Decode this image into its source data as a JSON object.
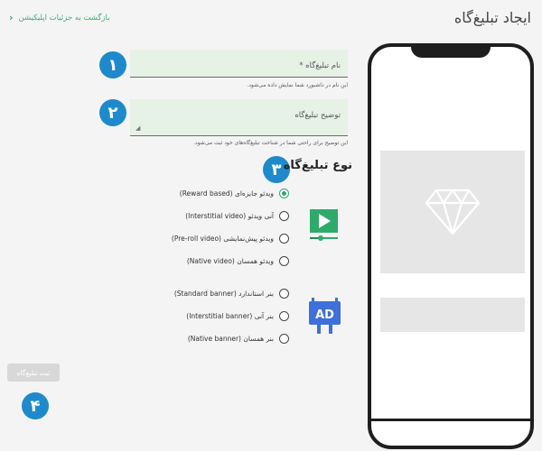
{
  "header": {
    "title": "ایجاد تبلیغ‌گاه",
    "back_label": "بازگشت به جزئیات اپلیکیشن"
  },
  "form": {
    "name_field": {
      "placeholder": "نام تبلیغ‌گاه *",
      "value": "",
      "hint": "این نام در داشبورد شما نمایش داده می‌شود."
    },
    "description_field": {
      "placeholder": "توضیح تبلیغ‌گاه",
      "value": "",
      "hint": "این توضیح برای راحتی شما در شناخت تبلیغ‌گاه‌های خود ثبت می‌شود."
    },
    "type_section_title": "نوع تبلیغ‌گاه",
    "video_options": [
      {
        "label": "ویدئو جایزه‌ای (Reward based)",
        "checked": true
      },
      {
        "label": "آنی ویدئو (Interstitial video)",
        "checked": false
      },
      {
        "label": "ویدئو پیش‌نمایشی (Pre-roll video)",
        "checked": false
      },
      {
        "label": "ویدئو همسان (Native video)",
        "checked": false
      }
    ],
    "banner_options": [
      {
        "label": "بنر استاندارد (Standard banner)",
        "checked": false
      },
      {
        "label": "بنر آنی (Interstitial banner)",
        "checked": false
      },
      {
        "label": "بنر همسان (Native banner)",
        "checked": false
      }
    ],
    "submit_label": "ثبت تبلیغ‌گاه"
  },
  "steps": [
    "۱",
    "۲",
    "۳",
    "۴"
  ],
  "icons": {
    "back": "chevron-left-icon",
    "video": "video-play-icon",
    "banner": "ad-banner-icon",
    "preview": "diamond-icon",
    "resize": "resize-handle-icon"
  },
  "colors": {
    "accent": "#3daa77",
    "step_badge": "#1e8acb",
    "field_bg": "#e6f2e6",
    "radio_checked": "#2eaa6a",
    "ad_icon": "#3f6fd8",
    "phone_frame": "#1e1e1e"
  }
}
